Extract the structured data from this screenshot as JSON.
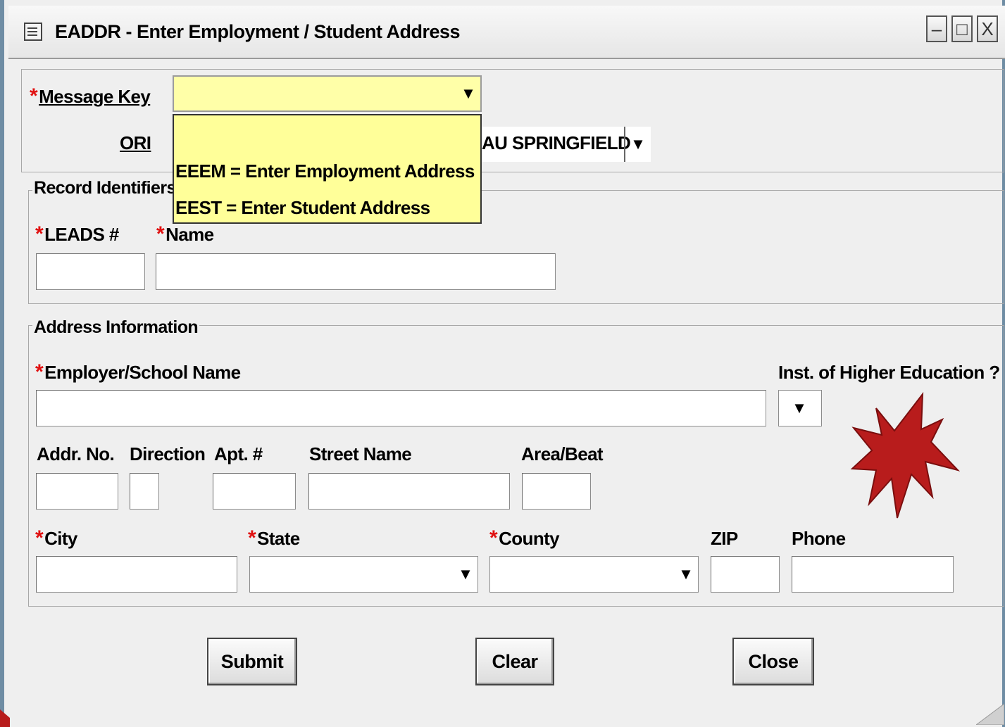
{
  "window": {
    "title": "EADDR - Enter Employment / Student  Address",
    "controls": {
      "minimize": "–",
      "maximize": "□",
      "close": "X"
    }
  },
  "header": {
    "message_key_label": "Message Key",
    "message_key_value": "",
    "ori_label": "ORI",
    "ori_value": "AU SPRINGFIELD",
    "message_key_options": [
      "EEEM = Enter Employment Address",
      "EEST = Enter Student Address"
    ]
  },
  "record_identifiers": {
    "legend": "Record Identifiers",
    "leads_label": "LEADS #",
    "name_label": "Name",
    "leads_value": "",
    "name_value": ""
  },
  "address": {
    "legend": "Address Information",
    "employer_label": "Employer/School Name",
    "higher_ed_label": "Inst. of Higher Education ?",
    "addr_no_label": "Addr. No.",
    "direction_label": "Direction",
    "apt_label": "Apt. #",
    "street_label": "Street Name",
    "area_label": "Area/Beat",
    "city_label": "City",
    "state_label": "State",
    "county_label": "County",
    "zip_label": "ZIP",
    "phone_label": "Phone"
  },
  "buttons": {
    "submit": "Submit",
    "clear": "Clear",
    "close": "Close"
  },
  "icons": {
    "dropdown": "▼",
    "required": "*"
  },
  "colors": {
    "required": "#e01010",
    "dropdown_bg": "#ffff99",
    "starburst": "#b81c1c"
  }
}
